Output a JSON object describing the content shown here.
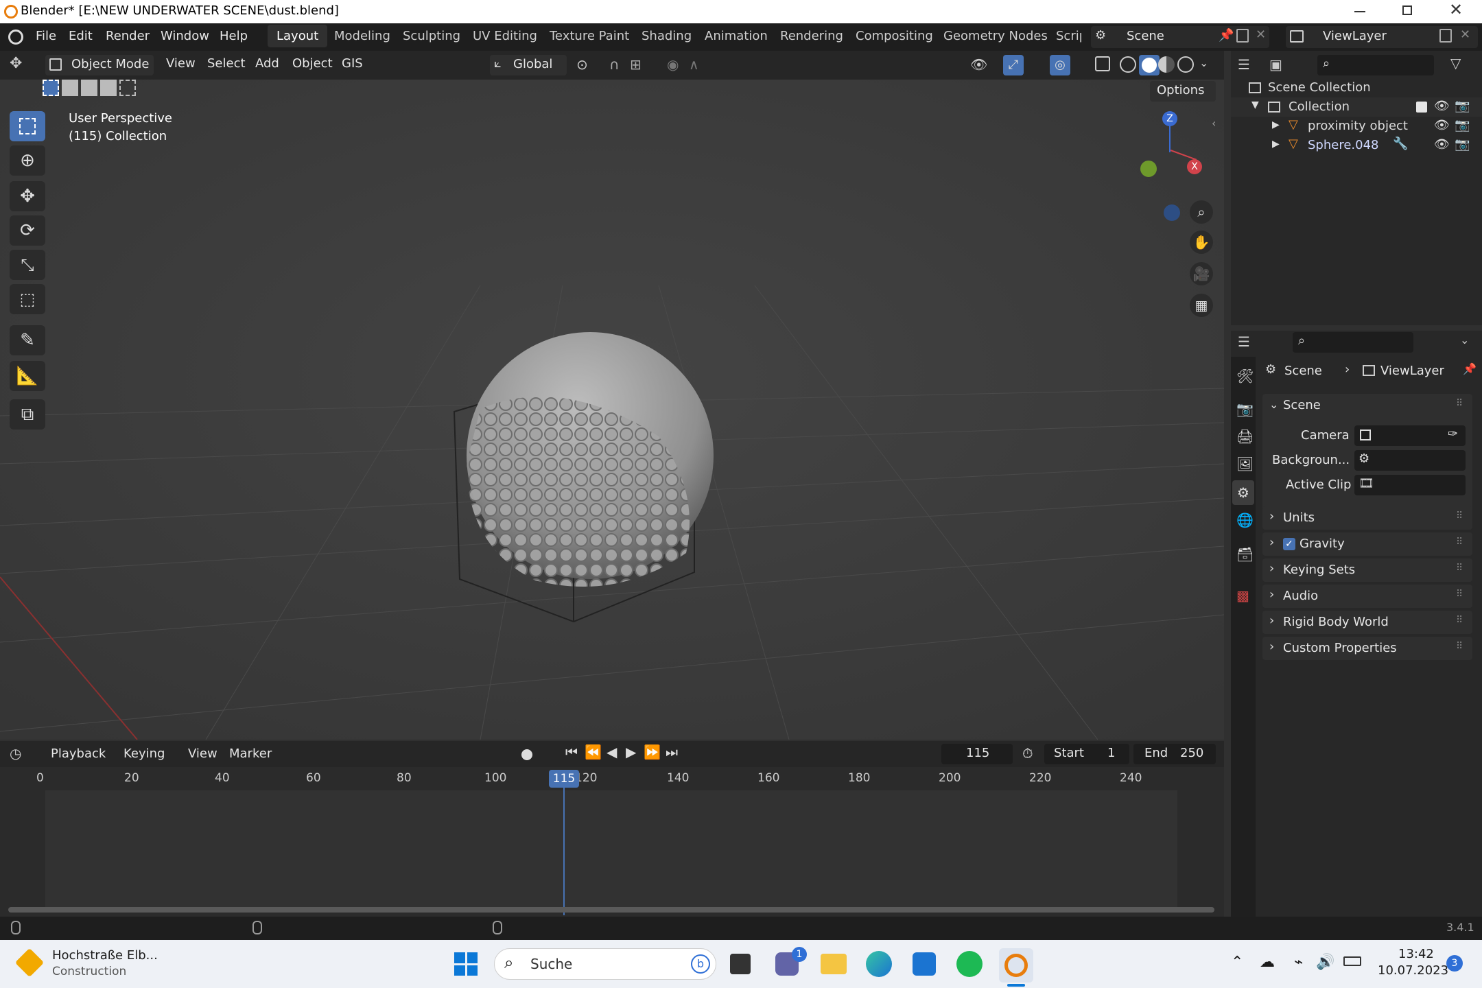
{
  "title": "Blender* [E:\\NEW UNDERWATER SCENE\\dust.blend]",
  "menu": [
    "File",
    "Edit",
    "Render",
    "Window",
    "Help"
  ],
  "workspaces": [
    "Layout",
    "Modeling",
    "Sculpting",
    "UV Editing",
    "Texture Paint",
    "Shading",
    "Animation",
    "Rendering",
    "Compositing",
    "Geometry Nodes",
    "Scrip"
  ],
  "scene_selector": "Scene",
  "viewlayer_selector": "ViewLayer",
  "viewport_header": {
    "mode": "Object Mode",
    "items": [
      "View",
      "Select",
      "Add",
      "Object",
      "GIS"
    ],
    "transform": "Global",
    "options": "Options"
  },
  "viewport": {
    "line1": "User Perspective",
    "line2": "(115) Collection"
  },
  "outliner": {
    "root": "Scene Collection",
    "collection": "Collection",
    "items": [
      "proximity object",
      "Sphere.048"
    ]
  },
  "properties": {
    "breadcrumb_scene": "Scene",
    "breadcrumb_layer": "ViewLayer",
    "section": "Scene",
    "camera_label": "Camera",
    "background_label": "Backgroun...",
    "clip_label": "Active Clip",
    "panels": [
      "Units",
      "Gravity",
      "Keying Sets",
      "Audio",
      "Rigid Body World",
      "Custom Properties"
    ]
  },
  "timeline": {
    "menus": [
      "Playback",
      "Keying",
      "View",
      "Marker"
    ],
    "current_frame": "115",
    "start_label": "Start",
    "start": "1",
    "end_label": "End",
    "end": "250",
    "ticks": [
      "0",
      "20",
      "40",
      "60",
      "80",
      "100",
      "120",
      "140",
      "160",
      "180",
      "200",
      "220",
      "240"
    ]
  },
  "version": "3.4.1",
  "taskbar": {
    "weather_title": "Hochstraße Elb...",
    "weather_sub": "Construction",
    "search": "Suche",
    "chat_badge": "1",
    "time": "13:42",
    "date": "10.07.2023",
    "notif": "3"
  },
  "colors": {
    "accent": "#4772b3",
    "blender_orange": "#e87d0d"
  }
}
